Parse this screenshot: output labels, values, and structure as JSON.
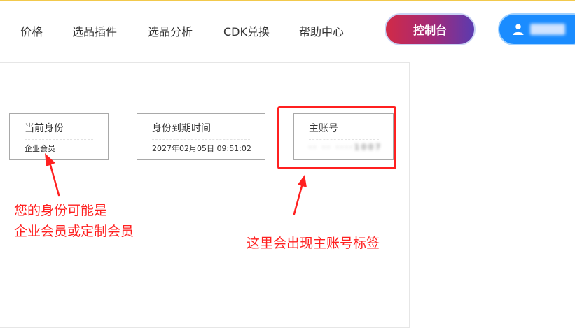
{
  "nav": {
    "items": [
      "价格",
      "选品插件",
      "选品分析",
      "CDK兑换",
      "帮助中心"
    ],
    "console_label": "控制台",
    "user_icon": "user-icon",
    "user_name_masked": true
  },
  "cards": [
    {
      "title": "当前身份",
      "value": "企业会员"
    },
    {
      "title": "身份到期时间",
      "value": "2027年02月05日 09:51:02"
    },
    {
      "title": "主账号",
      "value": "·· ·· ····1007"
    }
  ],
  "annotations": {
    "left_line1": "您的身份可能是",
    "left_line2": "企业会员或定制会员",
    "right": "这里会出现主账号标签"
  },
  "colors": {
    "annotation": "#ff2020",
    "console_gradient_start": "#d12a47",
    "console_gradient_end": "#5a3bb0",
    "user_button": "#1a8cff",
    "top_line": "#f2c94c"
  }
}
